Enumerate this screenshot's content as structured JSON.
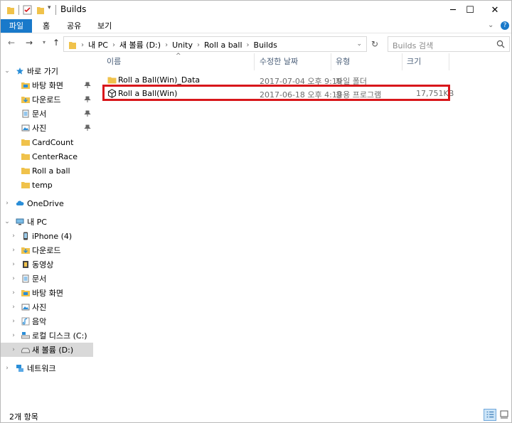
{
  "window": {
    "title": "Builds",
    "controls": {
      "minimize": "─",
      "maximize": "☐",
      "close": "✕"
    }
  },
  "ribbon": {
    "tabs": [
      {
        "label": "파일",
        "active": true
      },
      {
        "label": "홈"
      },
      {
        "label": "공유"
      },
      {
        "label": "보기"
      }
    ],
    "expand": "⌄",
    "help": "?"
  },
  "address": {
    "breadcrumbs": [
      "내 PC",
      "새 볼륨 (D:)",
      "Unity",
      "Roll a ball",
      "Builds"
    ],
    "search_placeholder": "Builds 검색"
  },
  "nav": {
    "quick_access": "바로 가기",
    "quick_items": [
      "바탕 화면",
      "다운로드",
      "문서",
      "사진",
      "CardCount",
      "CenterRace",
      "Roll a ball",
      "temp"
    ],
    "onedrive": "OneDrive",
    "this_pc": "내 PC",
    "pc_items": [
      "iPhone (4)",
      "다운로드",
      "동영상",
      "문서",
      "바탕 화면",
      "사진",
      "음악",
      "로컬 디스크 (C:)",
      "새 볼륨 (D:)"
    ],
    "network": "네트워크"
  },
  "columns": {
    "name": "이름",
    "date": "수정한 날짜",
    "type": "유형",
    "size": "크기"
  },
  "files": [
    {
      "name": "Roll a Ball(Win)_Data",
      "date": "2017-07-04 오후 9:19",
      "type": "파일 폴더",
      "size": "",
      "icon": "folder-icon"
    },
    {
      "name": "Roll a Ball(Win)",
      "date": "2017-06-18 오후 4:19",
      "type": "응용 프로그램",
      "size": "17,751KB",
      "icon": "unity-icon"
    }
  ],
  "status": {
    "count": "2개 항목"
  },
  "colors": {
    "accent": "#1979ca",
    "folder": "#f0c24b",
    "highlight": "#d8161b"
  }
}
